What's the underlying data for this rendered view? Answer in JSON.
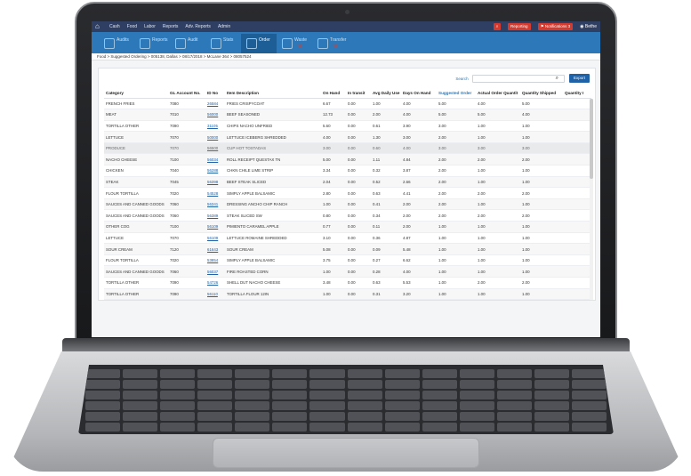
{
  "topbar": {
    "menu": [
      "Cash",
      "Food",
      "Labor",
      "Reports",
      "Adv. Reports",
      "Admin"
    ],
    "reporting_label": "Reporting",
    "notifications_label": "Notifications",
    "notifications_count": "3",
    "user_label": "Bethe",
    "colors": {
      "bar": "#2f3e63",
      "alert": "#d63a2f"
    }
  },
  "tabs": [
    {
      "label": "Audits",
      "count": ""
    },
    {
      "label": "Reports",
      "count": ""
    },
    {
      "label": "Audit",
      "count": ""
    },
    {
      "label": "Stats",
      "count": ""
    },
    {
      "label": "Order",
      "count": ""
    },
    {
      "label": "Waste",
      "count": "(0)"
    },
    {
      "label": "Transfer",
      "count": "(0)"
    }
  ],
  "breadcrumb": "Food > Suggested Ordering > 005138, Dallas > 08/17/2018 > McLane 364 > 08057524",
  "search": {
    "label": "Search",
    "placeholder": "",
    "value": ""
  },
  "export_label": "Export",
  "table": {
    "headers": [
      "Category",
      "GL Account No.",
      "ID No",
      "Item Description",
      "On Hand",
      "In transit",
      "Avg Daily Use",
      "Days On Hand",
      "Suggested Order",
      "Actual Order Quantit",
      "Quantity Shipped",
      "Quantity I"
    ],
    "rows": [
      [
        "FRENCH FRIES",
        "7080",
        "26584",
        "FRIES CRISPYCOAT",
        "6.67",
        "0.00",
        "1.00",
        "4.00",
        "5.00",
        "4.00",
        "5.00",
        ""
      ],
      [
        "MEAT",
        "7010",
        "56000",
        "BEEF SEASONED",
        "12.73",
        "0.00",
        "2.00",
        "4.00",
        "5.00",
        "5.00",
        "4.00",
        ""
      ],
      [
        "TORTILLA OTHER",
        "7090",
        "31105",
        "CHIPS NACHO UNFRIED",
        "5.60",
        "0.00",
        "0.61",
        "3.90",
        "3.00",
        "1.00",
        "1.00",
        ""
      ],
      [
        "LETTUCE",
        "7070",
        "50000",
        "LETTUCE ICEBERG SHREDDED",
        "4.00",
        "0.00",
        "1.30",
        "3.00",
        "2.00",
        "1.00",
        "1.00",
        ""
      ],
      [
        "PRODUCE",
        "7070",
        "56500",
        "CUP HOT TOSTADAS",
        "3.00",
        "0.00",
        "0.60",
        "4.00",
        "3.00",
        "3.00",
        "3.00",
        ""
      ],
      [
        "NACHO CHEESE",
        "7100",
        "56034",
        "ROLL RECEIPT QUESTAX TN",
        "5.00",
        "0.00",
        "1.11",
        "4.84",
        "2.00",
        "2.00",
        "2.00",
        ""
      ],
      [
        "CHICKEN",
        "7040",
        "56288",
        "CHKN CHILE LIME STRIP",
        "3.34",
        "0.00",
        "0.32",
        "3.87",
        "2.00",
        "1.00",
        "1.00",
        ""
      ],
      [
        "STEAK",
        "7045",
        "56398",
        "BEEF STEAK SLICED",
        "2.04",
        "0.00",
        "0.52",
        "2.66",
        "2.00",
        "1.00",
        "1.00",
        ""
      ],
      [
        "FLOUR TORTILLA",
        "7020",
        "54528",
        "SIMPLY APPLE BALSAMIC",
        "2.80",
        "0.00",
        "0.63",
        "4.41",
        "2.00",
        "2.00",
        "2.00",
        ""
      ],
      [
        "SAUCES AND CANNED GOODS",
        "7060",
        "56341",
        "DRESSING ANCHO CHIP RANCH",
        "1.00",
        "0.00",
        "0.41",
        "2.00",
        "2.00",
        "1.00",
        "1.00",
        ""
      ],
      [
        "SAUCES AND CANNED GOODS",
        "7060",
        "56389",
        "STEAK SLICED SW",
        "0.80",
        "0.00",
        "0.34",
        "2.00",
        "2.00",
        "2.00",
        "2.00",
        ""
      ],
      [
        "OTHER COG",
        "7100",
        "56109",
        "PIMIENTO CARAMEL APPLE",
        "0.77",
        "0.00",
        "0.11",
        "2.00",
        "1.00",
        "1.00",
        "1.00",
        ""
      ],
      [
        "LETTUCE",
        "7070",
        "56109",
        "LETTUCE ROMAINE SHREDDED",
        "3.10",
        "0.00",
        "0.36",
        "4.87",
        "1.00",
        "1.00",
        "1.00",
        ""
      ],
      [
        "SOUR CREAM",
        "7120",
        "61643",
        "SOUR CREAM",
        "5.08",
        "0.00",
        "0.09",
        "5.48",
        "1.00",
        "1.00",
        "1.00",
        ""
      ],
      [
        "FLOUR TORTILLA",
        "7020",
        "53854",
        "SIMPLY APPLE BALSAMIC",
        "3.75",
        "0.00",
        "0.27",
        "6.62",
        "1.00",
        "1.00",
        "1.00",
        ""
      ],
      [
        "SAUCES AND CANNED GOODS",
        "7060",
        "56037",
        "FIRE ROASTED CORN",
        "1.00",
        "0.00",
        "0.28",
        "4.00",
        "1.00",
        "1.00",
        "1.00",
        ""
      ],
      [
        "TORTILLA OTHER",
        "7090",
        "54726",
        "SHELL DUT NACHO CHEESE",
        "3.48",
        "0.00",
        "0.63",
        "5.53",
        "1.00",
        "2.00",
        "2.00",
        ""
      ],
      [
        "TORTILLA OTHER",
        "7090",
        "56110",
        "TORTILLA FLOUR 12IN",
        "1.00",
        "0.00",
        "0.31",
        "3.20",
        "1.00",
        "1.00",
        "1.00",
        ""
      ]
    ]
  }
}
